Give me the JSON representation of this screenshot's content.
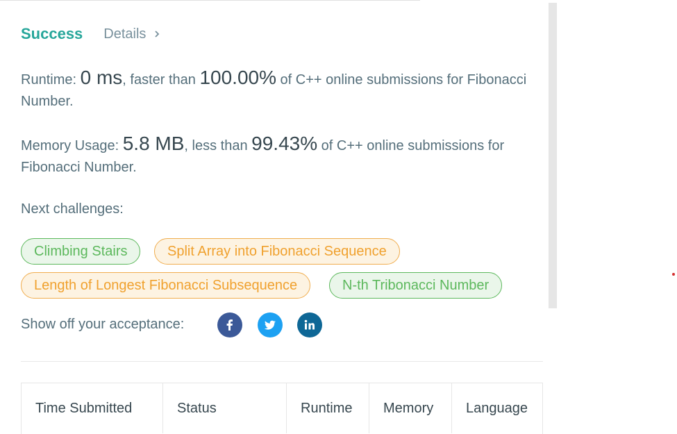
{
  "result": {
    "status": "Success",
    "details_label": "Details"
  },
  "runtime": {
    "label": "Runtime: ",
    "value": "0 ms",
    "mid": ", faster than ",
    "percent": "100.00%",
    "suffix": " of C++ online submissions for Fibonacci Number."
  },
  "memory": {
    "label": "Memory Usage: ",
    "value": "5.8 MB",
    "mid": ", less than ",
    "percent": "99.43%",
    "suffix": " of C++ online submissions for Fibonacci Number."
  },
  "next": {
    "label": "Next challenges:",
    "challenges": [
      {
        "label": "Climbing Stairs",
        "difficulty_color": "#5cb85c"
      },
      {
        "label": "Split Array into Fibonacci Sequence",
        "difficulty_color": "#f0ad4e"
      },
      {
        "label": "Length of Longest Fibonacci Subsequence",
        "difficulty_color": "#f0ad4e"
      },
      {
        "label": "N-th Tribonacci Number",
        "difficulty_color": "#5cb85c"
      }
    ]
  },
  "share": {
    "label": "Show off your acceptance:",
    "icons": [
      "facebook-icon",
      "twitter-icon",
      "linkedin-icon"
    ]
  },
  "table": {
    "headers": [
      "Time Submitted",
      "Status",
      "Runtime",
      "Memory",
      "Language"
    ]
  },
  "colors": {
    "success": "#26a69a",
    "easy": "#5cb85c",
    "medium": "#f0ad4e",
    "facebook": "#3b5998",
    "twitter": "#1da1f2",
    "linkedin": "#0e6796"
  }
}
